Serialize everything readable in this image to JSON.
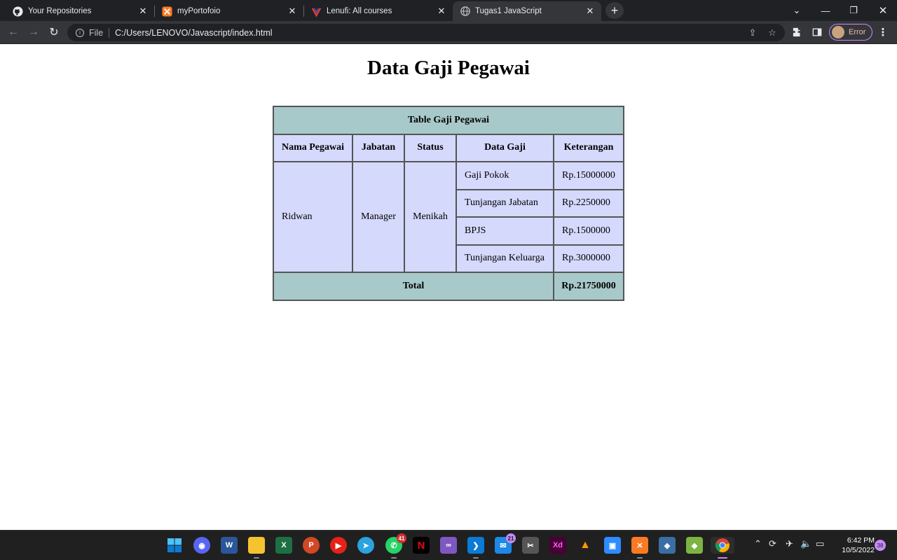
{
  "tabs": [
    {
      "title": "Your Repositories",
      "icon": "github-icon"
    },
    {
      "title": "myPortofoio",
      "icon": "xampp-icon"
    },
    {
      "title": "Lenufi: All courses",
      "icon": "lenufi-icon"
    },
    {
      "title": "Tugas1 JavaScript",
      "icon": "globe-icon",
      "active": true
    }
  ],
  "omnibox": {
    "scheme": "File",
    "url": "C:/Users/LENOVO/Javascript/index.html"
  },
  "profile": {
    "label": "Error"
  },
  "page": {
    "heading": "Data Gaji Pegawai",
    "table": {
      "caption": "Table Gaji Pegawai",
      "headers": [
        "Nama Pegawai",
        "Jabatan",
        "Status",
        "Data Gaji",
        "Keterangan"
      ],
      "employee": {
        "name": "Ridwan",
        "position": "Manager",
        "status": "Menikah"
      },
      "rows": [
        {
          "item": "Gaji Pokok",
          "amount": "Rp.15000000"
        },
        {
          "item": "Tunjangan Jabatan",
          "amount": "Rp.2250000"
        },
        {
          "item": "BPJS",
          "amount": "Rp.1500000"
        },
        {
          "item": "Tunjangan Keluarga",
          "amount": "Rp.3000000"
        }
      ],
      "total_label": "Total",
      "total_value": "Rp.21750000"
    }
  },
  "taskbar": {
    "badges": {
      "whatsapp": "41",
      "mail": "21",
      "notifications": "38"
    },
    "time": "6:42 PM",
    "date": "10/5/2022"
  },
  "colors": {
    "header_bg": "#a8c9c9",
    "cell_bg": "#d5d9fc",
    "border": "#555555",
    "chrome_dark": "#202124",
    "chrome_toolbar": "#35363a"
  }
}
